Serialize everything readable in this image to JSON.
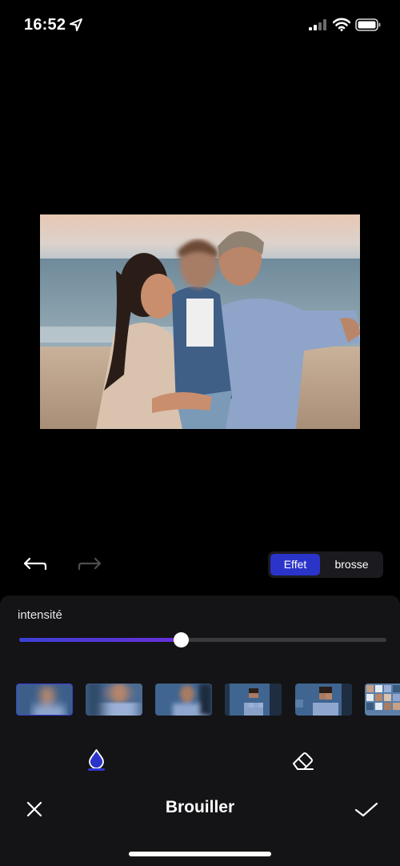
{
  "status_bar": {
    "time": "16:52",
    "icons": [
      "location-arrow-icon",
      "cellular-signal-icon",
      "wifi-icon",
      "battery-icon"
    ]
  },
  "toolbar": {
    "undo_icon": "undo-icon",
    "redo_icon": "redo-icon",
    "mode_toggle": {
      "options": [
        "Effet",
        "brosse"
      ],
      "selected": "Effet"
    }
  },
  "panel": {
    "intensity_label": "intensité",
    "intensity_value": 0.44,
    "effects": [
      {
        "name": "blur",
        "selected": true
      },
      {
        "name": "motion-blur",
        "selected": false
      },
      {
        "name": "zoom-blur",
        "selected": false
      },
      {
        "name": "pixelate",
        "selected": false
      },
      {
        "name": "pixelate-large",
        "selected": false
      },
      {
        "name": "mosaic",
        "selected": false
      }
    ],
    "modes": {
      "active": "drop-icon",
      "items": [
        "drop-icon",
        "eraser-icon"
      ]
    }
  },
  "bottom_bar": {
    "title": "Brouiller",
    "cancel_icon": "close-icon",
    "confirm_icon": "check-icon"
  },
  "colors": {
    "accent": "#2b34c9",
    "slider_fill_start": "#3b3fd6",
    "slider_fill_end": "#6a2fd8",
    "panel_bg": "#141416"
  }
}
